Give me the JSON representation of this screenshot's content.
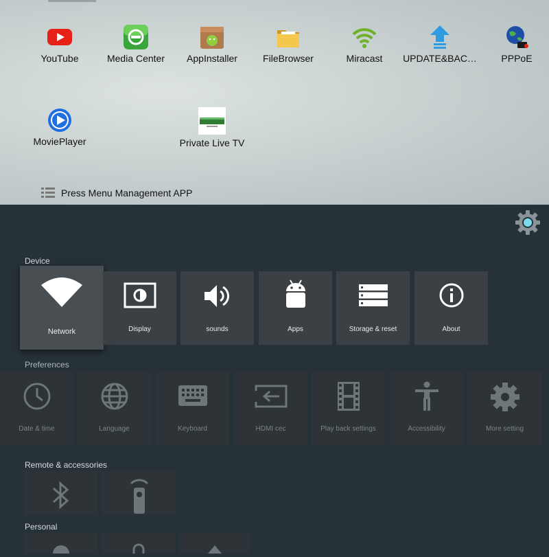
{
  "launcher": {
    "apps": [
      {
        "label": "YouTube",
        "icon": "youtube-icon"
      },
      {
        "label": "Media Center",
        "icon": "media-center-icon"
      },
      {
        "label": "AppInstaller",
        "icon": "app-installer-icon"
      },
      {
        "label": "FileBrowser",
        "icon": "folder-icon"
      },
      {
        "label": "Miracast",
        "icon": "wifi-signal-icon"
      },
      {
        "label": "UPDATE&BAC…",
        "icon": "update-arrow-icon"
      },
      {
        "label": "PPPoE",
        "icon": "globe-connection-icon"
      },
      {
        "label": "MoviePlayer",
        "icon": "play-icon"
      },
      {
        "label": "Private Live TV",
        "icon": "private-live-tv-logo"
      }
    ],
    "menu_hint": "Press Menu Management APP"
  },
  "settings": {
    "device": {
      "title": "Device",
      "tiles": [
        {
          "label": "Network",
          "icon": "wifi-icon"
        },
        {
          "label": "Display",
          "icon": "display-icon"
        },
        {
          "label": "sounds",
          "icon": "speaker-icon"
        },
        {
          "label": "Apps",
          "icon": "android-icon"
        },
        {
          "label": "Storage & reset",
          "icon": "storage-icon"
        },
        {
          "label": "About",
          "icon": "info-icon"
        }
      ]
    },
    "preferences": {
      "title": "Preferences",
      "tiles": [
        {
          "label": "Date & time",
          "icon": "clock-icon"
        },
        {
          "label": "Language",
          "icon": "globe-icon"
        },
        {
          "label": "Keyboard",
          "icon": "keyboard-icon"
        },
        {
          "label": "HDMI cec",
          "icon": "input-icon"
        },
        {
          "label": "Play back settings",
          "icon": "film-icon"
        },
        {
          "label": "Accessibility",
          "icon": "accessibility-icon"
        },
        {
          "label": "More setting",
          "icon": "gear-icon"
        }
      ]
    },
    "remote": {
      "title": "Remote & accessories",
      "tiles": [
        {
          "icon": "bluetooth-icon"
        },
        {
          "icon": "remote-icon"
        }
      ]
    },
    "personal": {
      "title": "Personal"
    }
  },
  "colors": {
    "accent_gear": "#7fd9ee",
    "youtube_red": "#e62117",
    "media_green": "#3aa53a",
    "folder_yellow": "#e9b936",
    "wifi_green": "#6fb02c",
    "update_blue": "#2f9be0",
    "play_blue": "#1f6fe0"
  }
}
